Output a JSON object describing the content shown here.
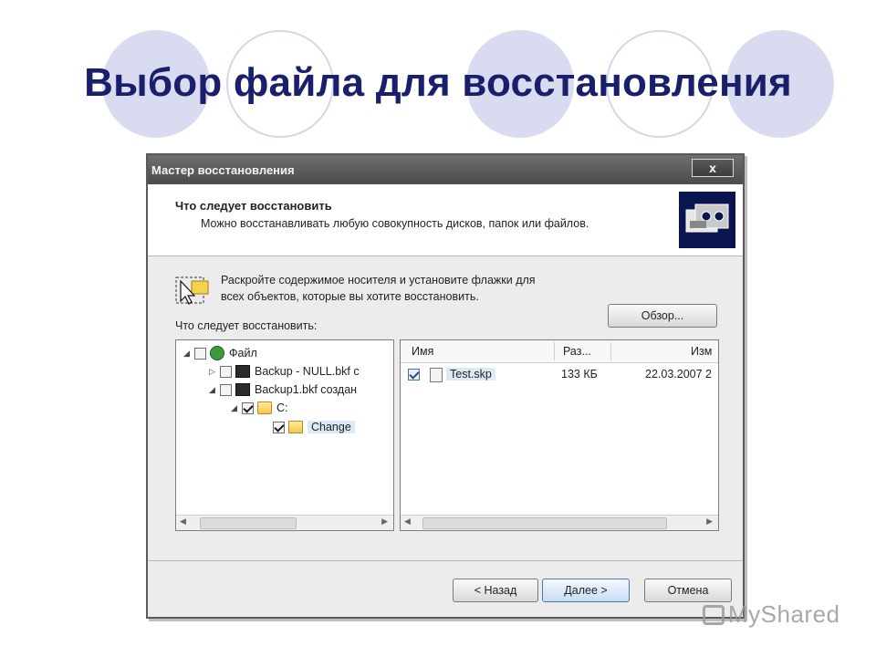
{
  "slide": {
    "title": "Выбор файла для восстановления"
  },
  "dialog": {
    "title": "Мастер восстановления",
    "close_label": "x",
    "header_title": "Что следует восстановить",
    "header_subtitle": "Можно восстанавливать любую совокупность дисков, папок или файлов.",
    "instruction_line1": "Раскройте содержимое носителя и установите флажки для",
    "instruction_line2": "всех объектов, которые вы хотите восстановить.",
    "browse_label": "Обзор...",
    "what_label": "Что следует восстановить:",
    "tree": [
      {
        "label": "Файл",
        "icon": "file-icon",
        "expander": "◢",
        "checked": false
      },
      {
        "label": "Backup - NULL.bkf с",
        "icon": "tape-icon",
        "expander": "▷",
        "checked": false
      },
      {
        "label": "Backup1.bkf создан",
        "icon": "tape-icon",
        "expander": "◢",
        "checked": false
      },
      {
        "label": "C:",
        "icon": "folder-icon",
        "expander": "◢",
        "checked": true
      },
      {
        "label": "Change",
        "icon": "folder-icon",
        "expander": "",
        "checked": true,
        "selected": true
      }
    ],
    "columns": [
      "Имя",
      "Раз...",
      "Изм"
    ],
    "files": [
      {
        "name": "Test.skp",
        "size": "133 КБ",
        "modified": "22.03.2007 2",
        "checked": true
      }
    ],
    "buttons": {
      "back": "< Назад",
      "next": "Далее >",
      "cancel": "Отмена"
    }
  },
  "watermark": "MyShared",
  "colors": {
    "title": "#1a1f6b",
    "circle_fill": "#d9dbf0",
    "titlebar": "#4b4b4b"
  }
}
